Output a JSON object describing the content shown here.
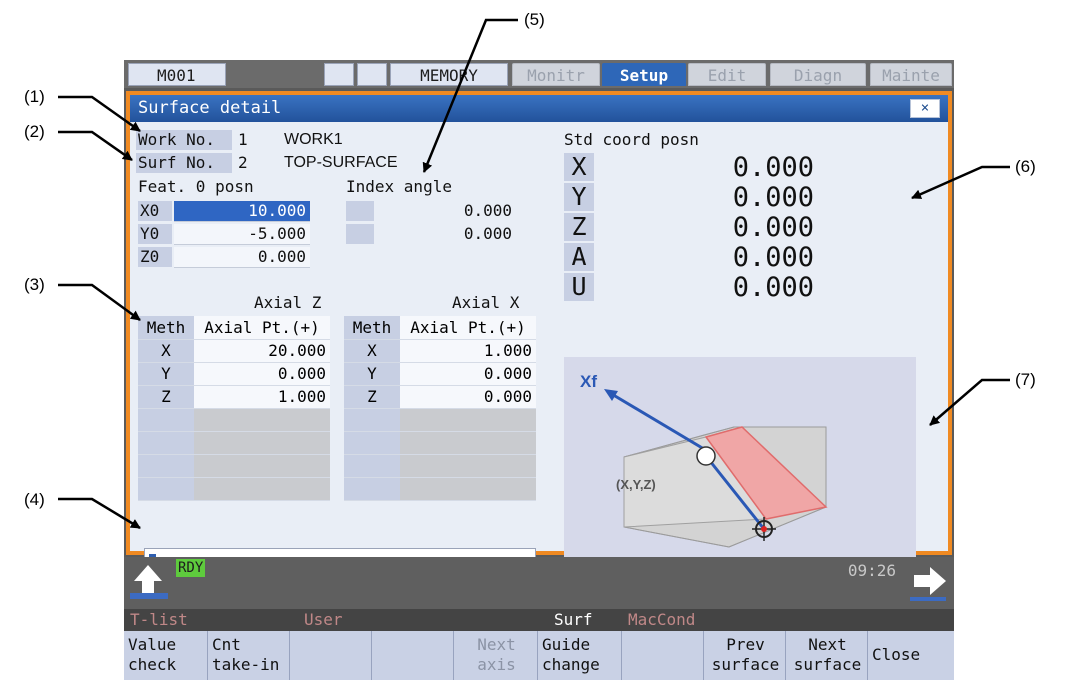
{
  "callouts": [
    "(1)",
    "(2)",
    "(3)",
    "(4)",
    "(5)",
    "(6)",
    "(7)"
  ],
  "topbar": {
    "program": "M001",
    "mode": "MEMORY",
    "tabs": [
      {
        "label": "Monitr",
        "active": false
      },
      {
        "label": "Setup",
        "active": true
      },
      {
        "label": "Edit",
        "active": false
      },
      {
        "label": "Diagn",
        "active": false
      },
      {
        "label": "Mainte",
        "active": false
      }
    ]
  },
  "window": {
    "title": "Surface detail",
    "close_label": "×",
    "work_no": {
      "label": "Work No.",
      "number": "1",
      "name": "WORK1"
    },
    "surf_no": {
      "label": "Surf No.",
      "number": "2",
      "name": "TOP-SURFACE"
    },
    "feat0": {
      "title": "Feat. 0 posn",
      "rows": [
        {
          "axis": "X0",
          "value": "10.000"
        },
        {
          "axis": "Y0",
          "value": "-5.000"
        },
        {
          "axis": "Z0",
          "value": "0.000"
        }
      ]
    },
    "index_angle": {
      "title": "Index angle",
      "rows": [
        {
          "axis": "",
          "value": "0.000"
        },
        {
          "axis": "",
          "value": "0.000"
        }
      ]
    },
    "std_coord": {
      "title": "Std coord posn",
      "rows": [
        {
          "axis": "X",
          "value": "0.000"
        },
        {
          "axis": "Y",
          "value": "0.000"
        },
        {
          "axis": "Z",
          "value": "0.000"
        },
        {
          "axis": "A",
          "value": "0.000"
        },
        {
          "axis": "U",
          "value": "0.000"
        }
      ]
    },
    "axial_z": {
      "title": "Axial Z",
      "meth_header": "Meth",
      "pt_header": "Axial Pt.(+)",
      "rows": [
        {
          "axis": "X",
          "value": "20.000"
        },
        {
          "axis": "Y",
          "value": "0.000"
        },
        {
          "axis": "Z",
          "value": "1.000"
        }
      ]
    },
    "axial_x": {
      "title": "Axial X",
      "meth_header": "Meth",
      "pt_header": "Axial Pt.(+)",
      "rows": [
        {
          "axis": "X",
          "value": "1.000"
        },
        {
          "axis": "Y",
          "value": "0.000"
        },
        {
          "axis": "Z",
          "value": "0.000"
        }
      ]
    },
    "guide": {
      "axis_label": "Xf",
      "point_label": "(X,Y,Z)"
    }
  },
  "status": {
    "ready": "RDY",
    "clock": "09:26"
  },
  "menu_row": [
    {
      "label": "T-list",
      "color": "#c08888"
    },
    {
      "label": "User",
      "color": "#c08888"
    },
    {
      "label": "Surf",
      "color": "#ffffff"
    },
    {
      "label": "MacCond",
      "color": "#c08888"
    }
  ],
  "function_keys": [
    {
      "line1": "Value",
      "line2": "check",
      "enabled": true
    },
    {
      "line1": "Cnt",
      "line2": "take-in",
      "enabled": true
    },
    {
      "line1": "",
      "line2": "",
      "enabled": true
    },
    {
      "line1": "",
      "line2": "",
      "enabled": true
    },
    {
      "line1": "Next",
      "line2": "axis",
      "enabled": false
    },
    {
      "line1": "Guide",
      "line2": "change",
      "enabled": true
    },
    {
      "line1": "",
      "line2": "",
      "enabled": true
    },
    {
      "line1": "Prev",
      "line2": "surface",
      "enabled": true
    },
    {
      "line1": "Next",
      "line2": "surface",
      "enabled": true
    },
    {
      "line1": "Close",
      "line2": "",
      "enabled": true
    }
  ]
}
